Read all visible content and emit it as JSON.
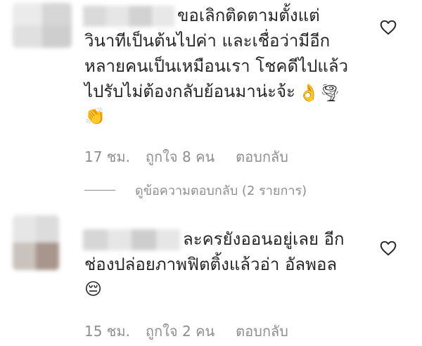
{
  "comments": [
    {
      "text": "ขอเลิกติดตามตั้งแต่\nวินาทีเป็นต้นไปค่า และเชื่อว่ามีอีก\nหลายคนเป็นเหมือนเรา โชคดีไปแล้ว\nไปรับไม่ต้องกลับย้อนมาน่ะจ้ะ",
      "emoji_inline": "👌🌪",
      "emoji_line": "👏",
      "time": "17 ชม.",
      "likes": "ถูกใจ 8 คน",
      "reply": "ตอบกลับ",
      "view_replies": "ดูข้อความตอบกลับ (2 รายการ)",
      "heart_icon": "heart-outline-icon"
    },
    {
      "text": "ละครยังออนอยู่เลย อีก\nช่องปล่อยภาพฟิตติ้งแล้วอ่า อัลพอล",
      "emoji_line": "😔",
      "time": "15 ชม.",
      "likes": "ถูกใจ 2 คน",
      "reply": "ตอบกลับ",
      "heart_icon": "heart-outline-icon"
    }
  ],
  "colors": {
    "text": "#262626",
    "meta": "#8e8e8e",
    "avatar1": [
      "#e9e9e9",
      "#d8d8d8",
      "#dedede",
      "#cfcfcf"
    ],
    "avatar2": [
      "#e4e4e4",
      "#dcdcdc",
      "#bfb7b2",
      "#a8958c"
    ],
    "username_blur": [
      "#d9d9d9",
      "#e4e4e4",
      "#cfcfcf",
      "#e8e8e8"
    ]
  }
}
